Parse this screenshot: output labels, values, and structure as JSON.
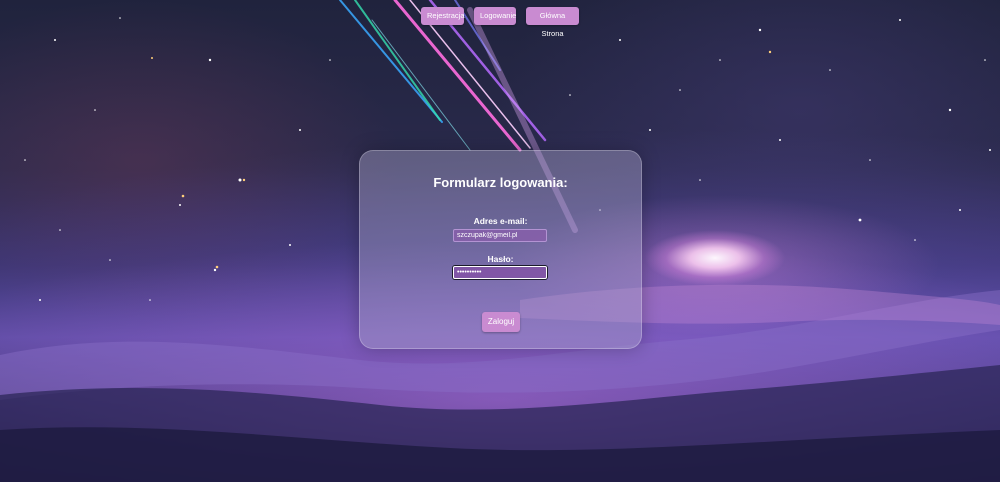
{
  "nav": {
    "register_label": "Rejestracja",
    "login_label": "Logowanie",
    "home_label": "Główna Strona"
  },
  "login_form": {
    "title": "Formularz logowania:",
    "email_label": "Adres e-mail:",
    "email_value": "szczupak@gmeil.pl",
    "password_label": "Hasło:",
    "password_mask": "••••••••••",
    "submit_label": "Zaloguj"
  },
  "colors": {
    "button": "#c98bd1",
    "input_background": "#875faa",
    "card": "#aaa5c8"
  }
}
